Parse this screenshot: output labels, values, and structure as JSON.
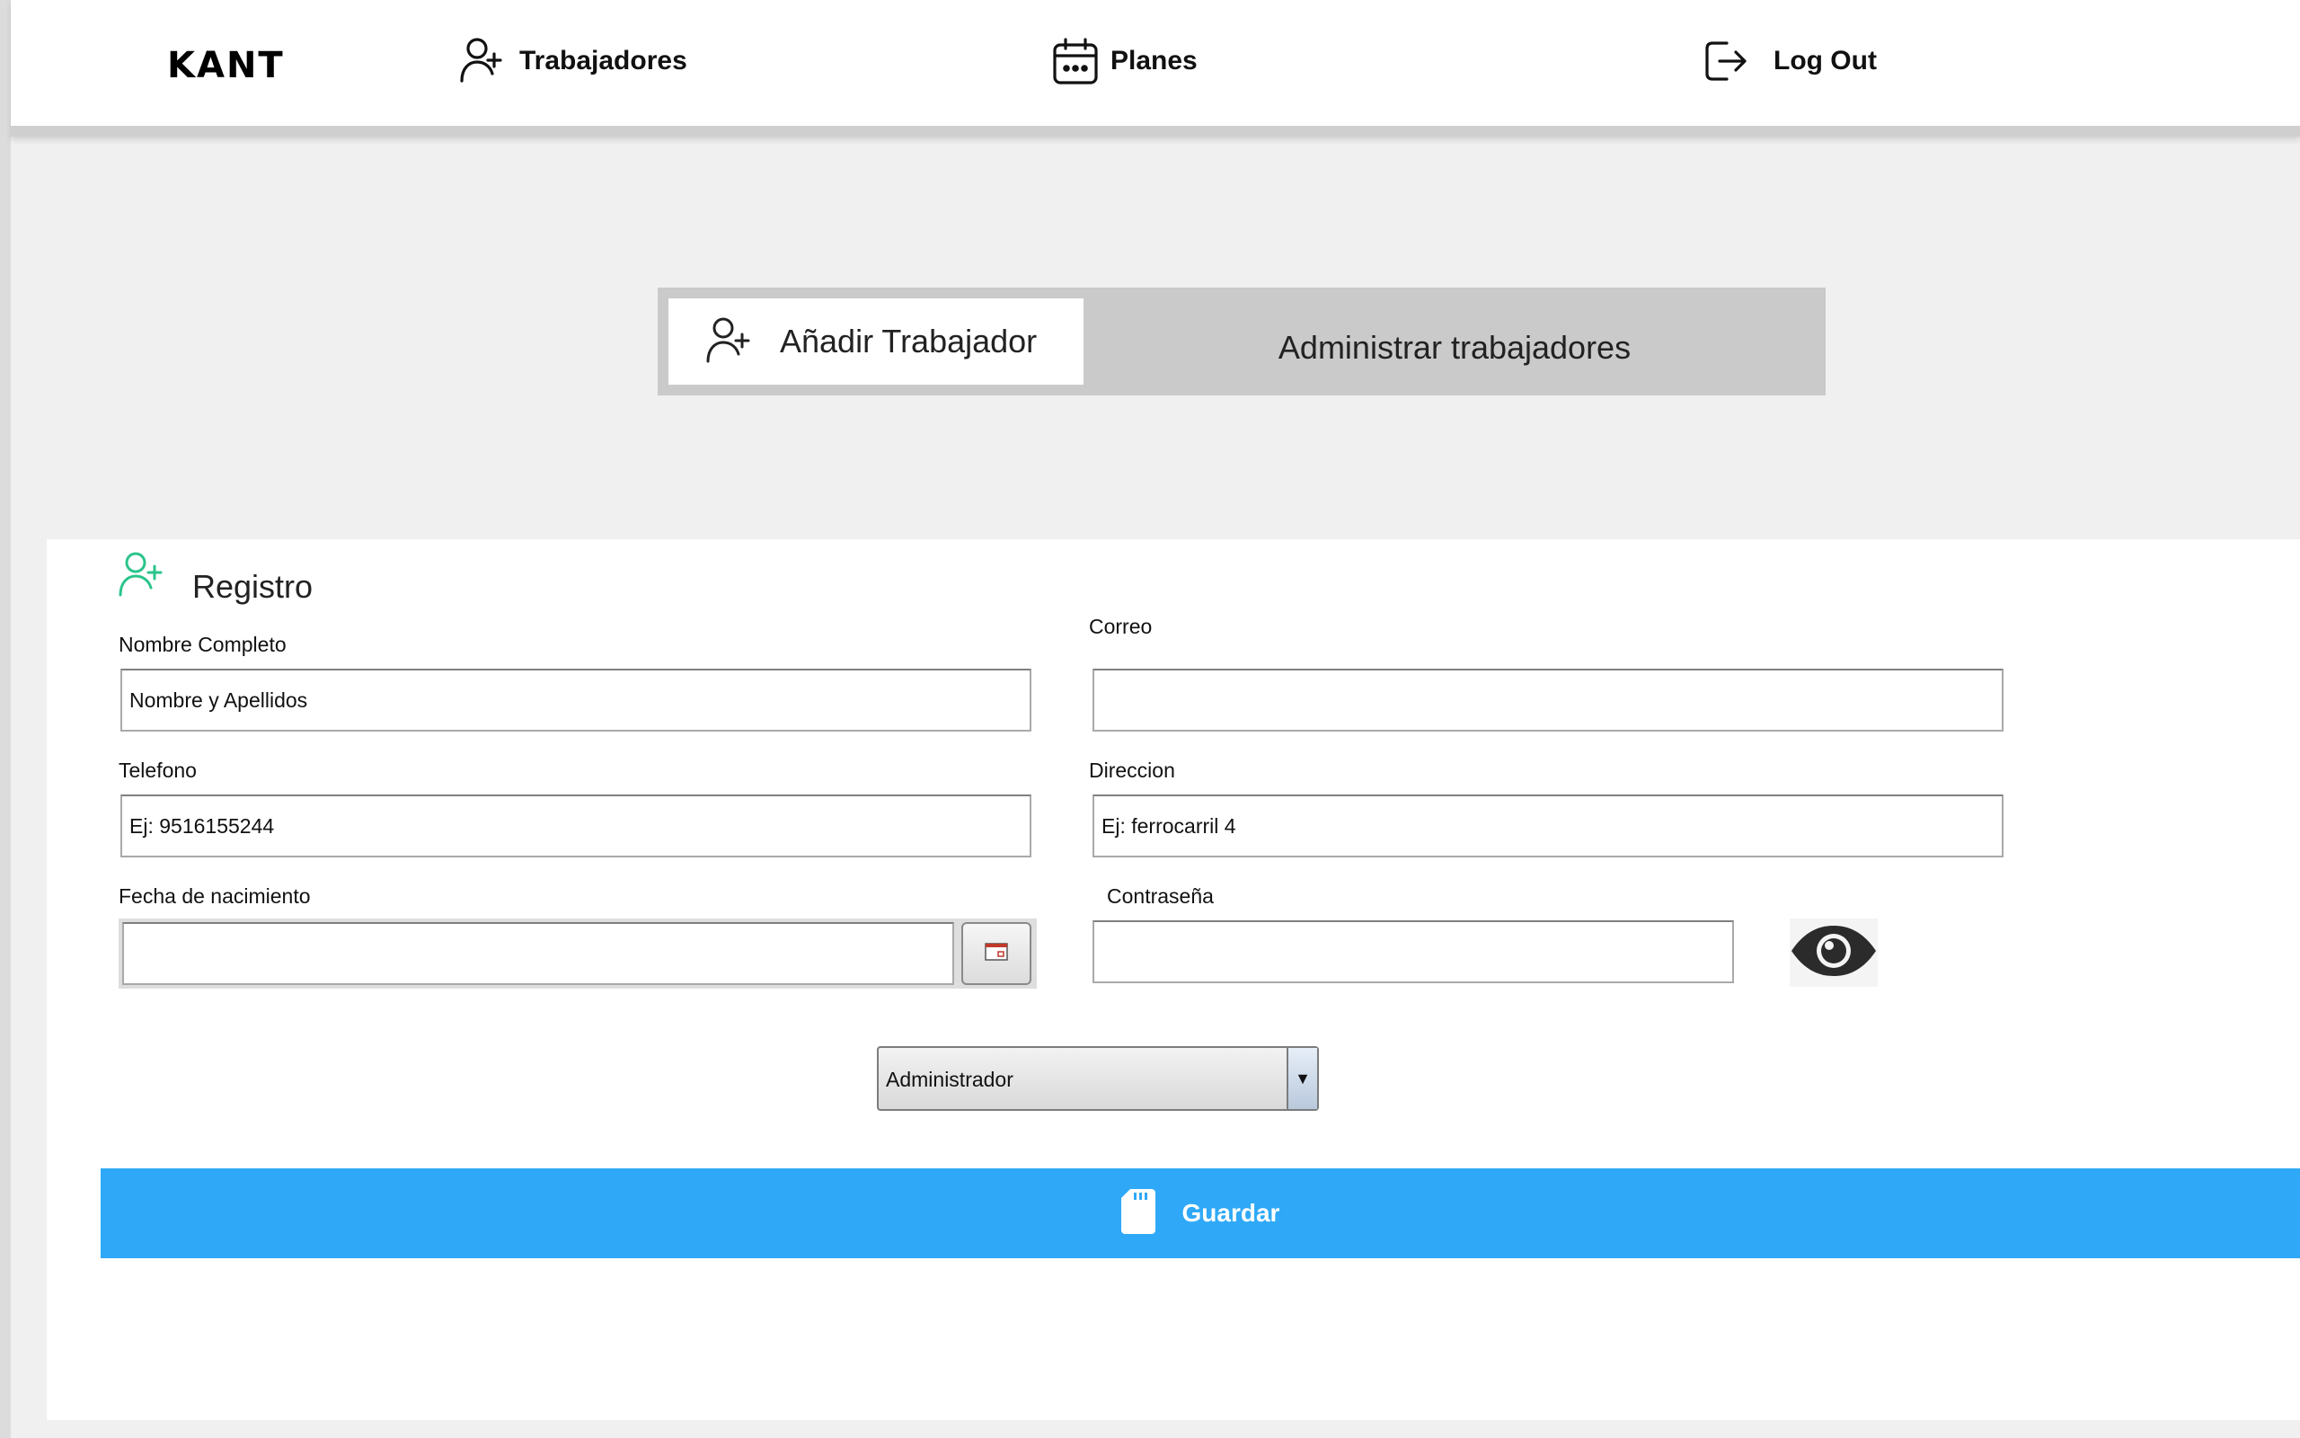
{
  "colors": {
    "accent_blue": "#2fa9f7",
    "accent_green": "#2bc48a",
    "tab_bg": "#cacaca"
  },
  "header": {
    "logo_text": "KANT",
    "nav": [
      {
        "label": "Trabajadores",
        "icon": "person-add-icon"
      },
      {
        "label": "Planes",
        "icon": "calendar-icon"
      },
      {
        "label": "Log Out",
        "icon": "logout-icon"
      }
    ]
  },
  "tabs": [
    {
      "label": "Añadir Trabajador",
      "icon": "person-add-icon",
      "active": true
    },
    {
      "label": "Administrar trabajadores",
      "active": false
    }
  ],
  "form": {
    "title": "Registro",
    "title_icon": "person-add-icon",
    "fields": {
      "nombre": {
        "label": "Nombre Completo",
        "placeholder": "Nombre y Apellidos",
        "value": ""
      },
      "correo": {
        "label": "Correo",
        "placeholder": "",
        "value": ""
      },
      "telefono": {
        "label": "Telefono",
        "placeholder": "Ej: 9516155244",
        "value": ""
      },
      "direccion": {
        "label": "Direccion",
        "placeholder": "Ej: ferrocarril 4",
        "value": ""
      },
      "fecha": {
        "label": "Fecha de nacimiento",
        "value": "",
        "button_icon": "calendar-picker-icon"
      },
      "contrasena": {
        "label": "Contraseña",
        "value": "",
        "toggle_icon": "eye-icon"
      }
    },
    "role_select": {
      "selected": "Administrador"
    },
    "save_button": {
      "label": "Guardar",
      "icon": "sd-card-icon"
    }
  }
}
